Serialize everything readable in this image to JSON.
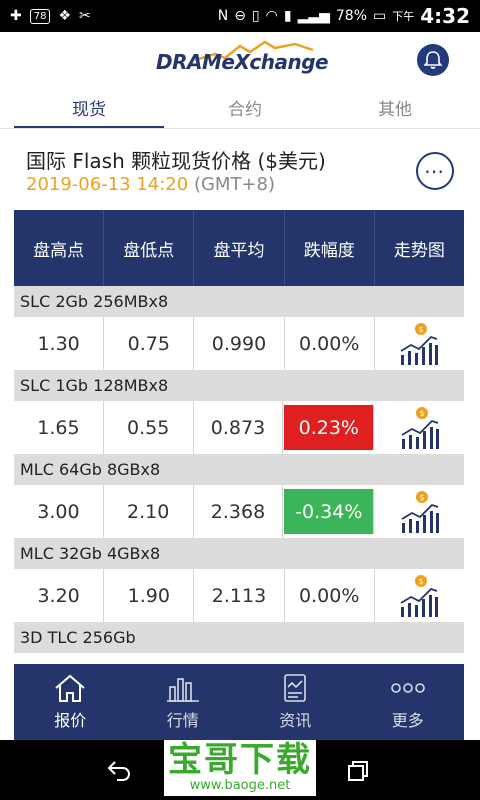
{
  "status_bar": {
    "badge": "78",
    "battery_percent": "78%",
    "time_prefix": "下午",
    "time": "4:32"
  },
  "header": {
    "logo_text": "DRAMeXchange",
    "bell_icon": "bell-icon"
  },
  "tabs": [
    {
      "label": "现货",
      "active": true
    },
    {
      "label": "合约",
      "active": false
    },
    {
      "label": "其他",
      "active": false
    }
  ],
  "page": {
    "title": "国际 Flash 颗粒现货价格 ($美元)",
    "datetime": "2019-06-13 14:20",
    "timezone": "(GMT+8)",
    "more_icon": "more-icon"
  },
  "table": {
    "columns": [
      "盘高点",
      "盘低点",
      "盘平均",
      "跌幅度",
      "走势图"
    ],
    "sections": [
      {
        "name": "SLC 2Gb 256MBx8",
        "high": "1.30",
        "low": "0.75",
        "avg": "0.990",
        "change": "0.00%",
        "trend": "neutral"
      },
      {
        "name": "SLC 1Gb 128MBx8",
        "high": "1.65",
        "low": "0.55",
        "avg": "0.873",
        "change": "0.23%",
        "trend": "up"
      },
      {
        "name": "MLC 64Gb 8GBx8",
        "high": "3.00",
        "low": "2.10",
        "avg": "2.368",
        "change": "-0.34%",
        "trend": "down"
      },
      {
        "name": "MLC 32Gb 4GBx8",
        "high": "3.20",
        "low": "1.90",
        "avg": "2.113",
        "change": "0.00%",
        "trend": "neutral"
      },
      {
        "name": "3D TLC  256Gb"
      }
    ],
    "trend_icon": "trend-chart-icon"
  },
  "bottom_nav": [
    {
      "label": "报价",
      "icon": "home-icon",
      "active": true
    },
    {
      "label": "行情",
      "icon": "bar-chart-icon",
      "active": false
    },
    {
      "label": "资讯",
      "icon": "news-icon",
      "active": false
    },
    {
      "label": "更多",
      "icon": "more-dots-icon",
      "active": false
    }
  ],
  "watermark": {
    "main": "宝哥下载",
    "url": "www.baoge.net"
  },
  "colors": {
    "primary": "#23356b",
    "accent_orange": "#f0a020",
    "up_red": "#e02020",
    "down_green": "#3cb55a"
  }
}
